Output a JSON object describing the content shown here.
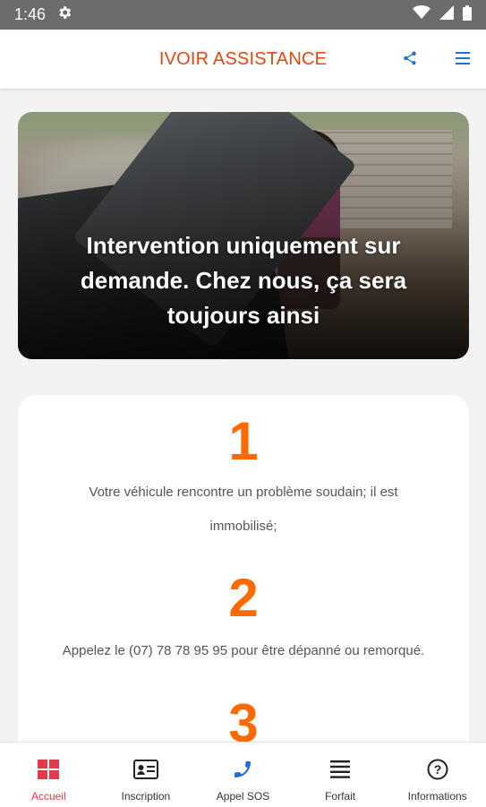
{
  "status_bar": {
    "time": "1:46",
    "icons": [
      "settings-icon",
      "wifi-icon",
      "signal-icon",
      "battery-icon"
    ]
  },
  "app_bar": {
    "title": "IVOIR ASSISTANCE",
    "actions": [
      "share-icon",
      "menu-icon"
    ],
    "accent_color": "#e8450f"
  },
  "hero": {
    "headline": "Intervention uniquement sur demande. Chez nous, ça sera toujours ainsi"
  },
  "steps": [
    {
      "number": "1",
      "text": "Votre véhicule rencontre un problème soudain; il est immobilisé;"
    },
    {
      "number": "2",
      "text": "Appelez le (07) 78 78 95 95 pour être dépanné ou remorqué."
    },
    {
      "number": "3",
      "text": ""
    }
  ],
  "bottom_nav": {
    "active_color": "#e3394b",
    "items": [
      {
        "label": "Accueil",
        "icon": "home-grid-icon",
        "active": true
      },
      {
        "label": "Inscription",
        "icon": "id-card-icon",
        "active": false
      },
      {
        "label": "Appel SOS",
        "icon": "phone-icon",
        "active": false
      },
      {
        "label": "Forfait",
        "icon": "list-icon",
        "active": false
      },
      {
        "label": "Informations",
        "icon": "help-icon",
        "active": false
      }
    ]
  },
  "colors": {
    "step_number": "#ff6a00",
    "icon_blue": "#1e6fd9"
  }
}
